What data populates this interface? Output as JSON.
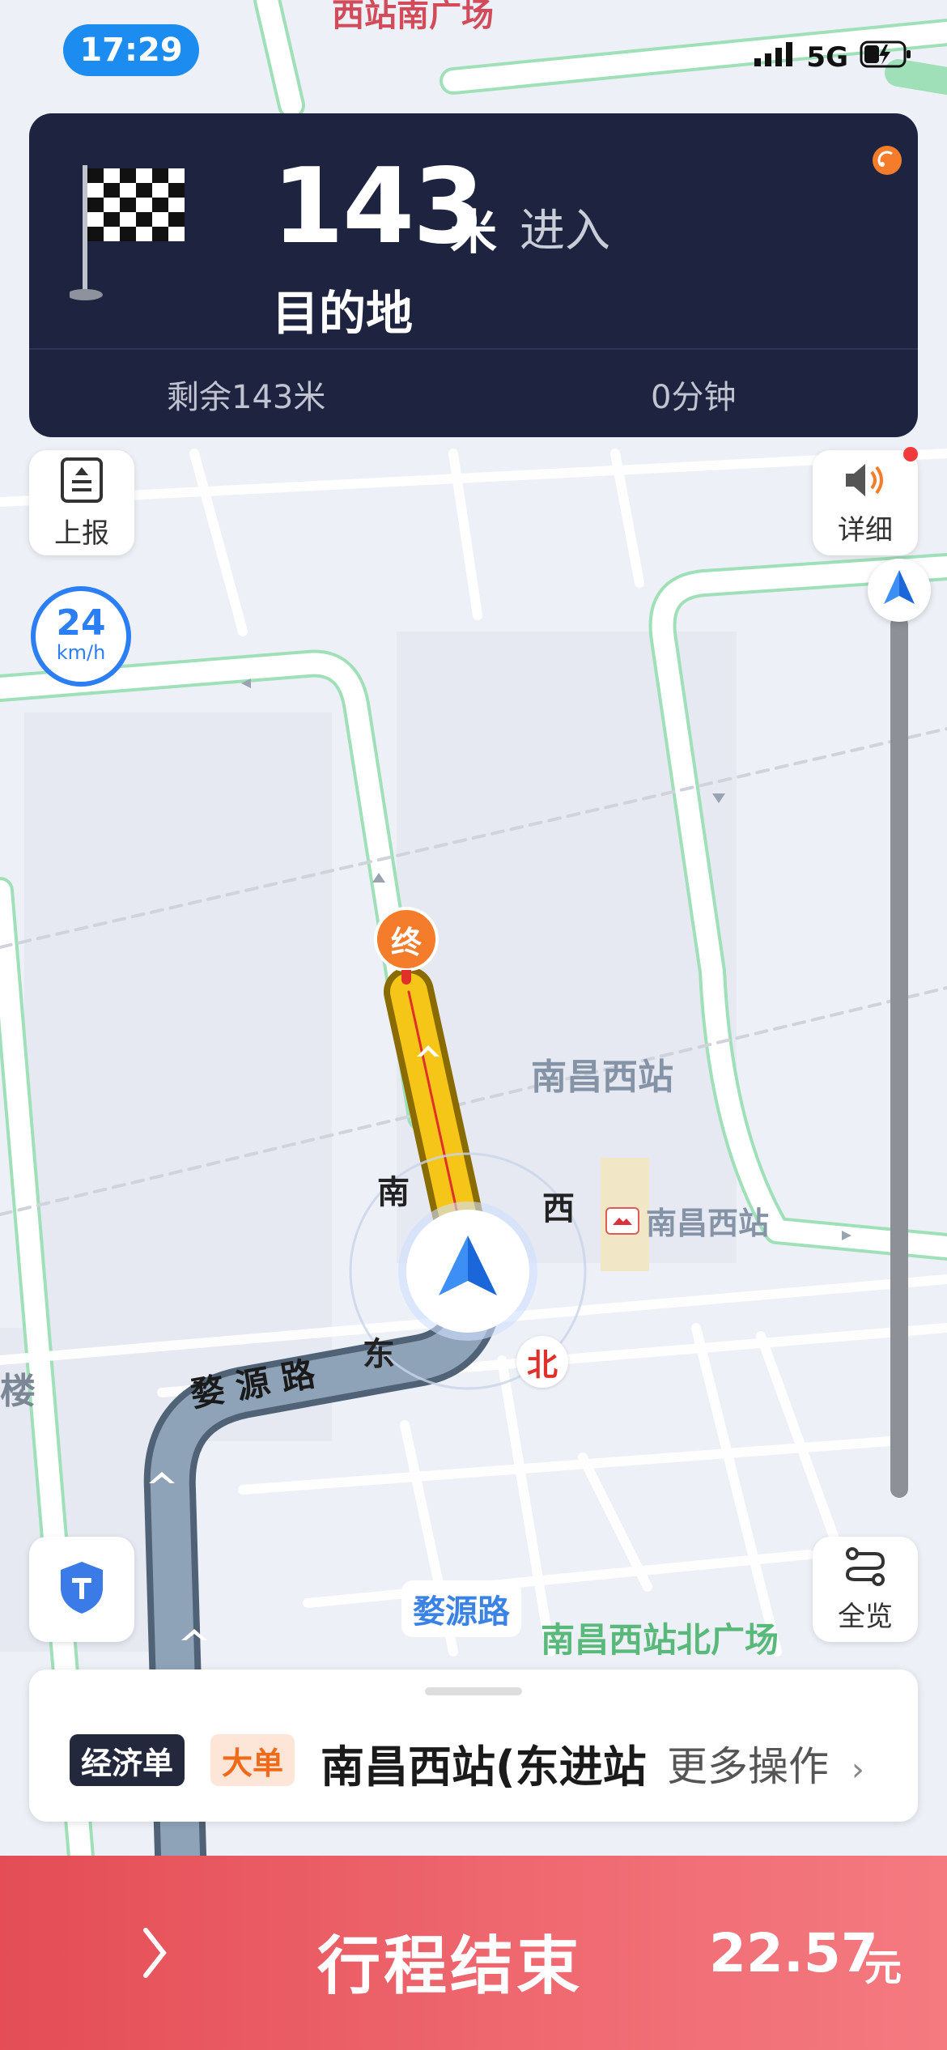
{
  "status_bar": {
    "time": "17:29",
    "network": "5G"
  },
  "navigation": {
    "distance": "143",
    "distance_unit": "米",
    "action": "进入",
    "target": "目的地",
    "remaining_distance": "剩余143米",
    "remaining_time": "0分钟"
  },
  "left_controls": {
    "report_label": "上报",
    "speed_value": "24",
    "speed_unit": "km/h"
  },
  "right_controls": {
    "detail_label": "详细",
    "overview_label": "全览"
  },
  "map": {
    "end_marker": "终",
    "station_area": "南昌西站",
    "station_poi": "南昌西站",
    "road_name": "婺 源 路",
    "road_tag": "婺源路",
    "square": "南昌西站北广场",
    "top_poi": "西站南广场",
    "left_edge": "楼",
    "compass": {
      "south": "南",
      "west": "西",
      "east": "东",
      "north": "北"
    }
  },
  "order": {
    "tag_economy": "经济单",
    "tag_big": "大单",
    "destination": "南昌西站(东进站",
    "more_label": "更多操作"
  },
  "trip": {
    "end_label": "行程结束",
    "fare": "22.57",
    "fare_unit": "元"
  },
  "colors": {
    "route": "#f5c518",
    "driven_route": "#6c7f95",
    "nav_card": "#1e2440",
    "accent": "#2c7ef5",
    "end_bar": "#e44d55"
  }
}
